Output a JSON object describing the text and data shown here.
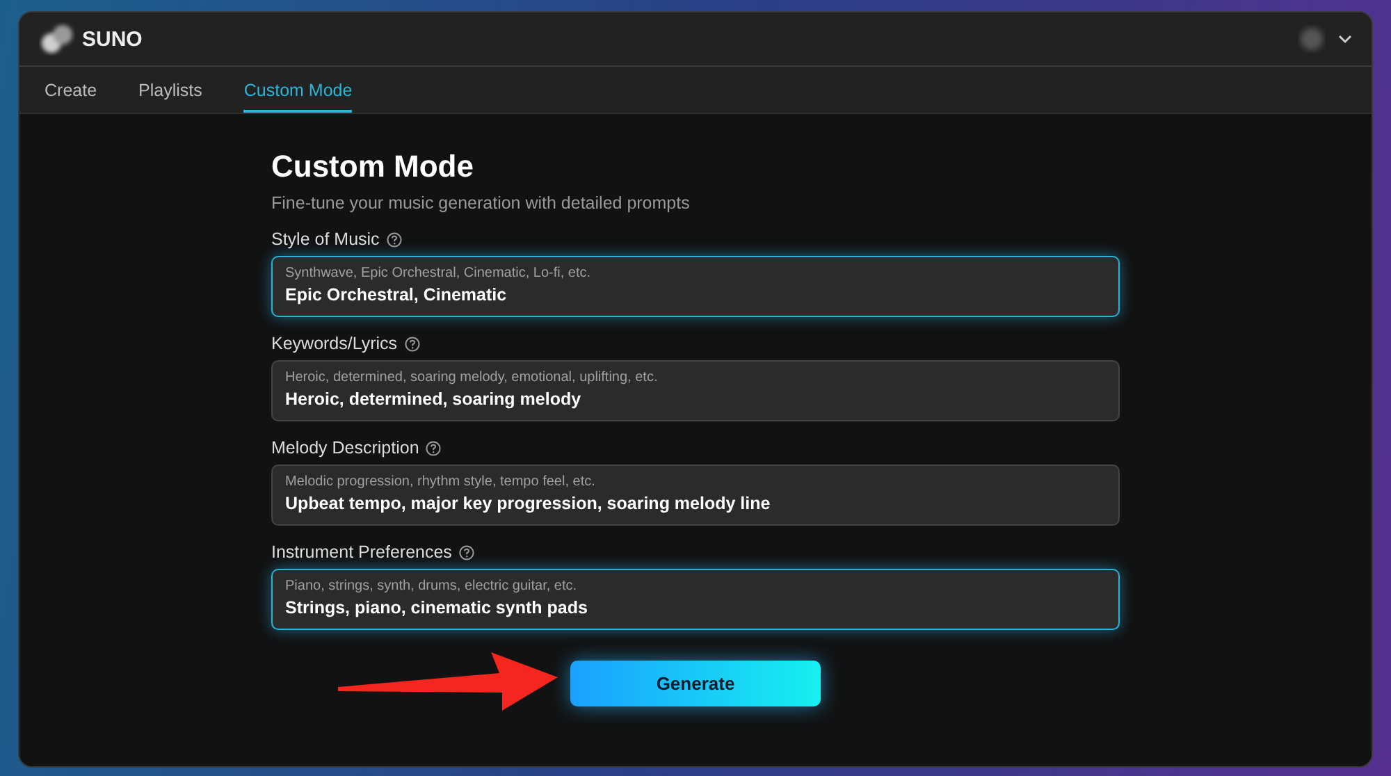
{
  "app": {
    "name": "SUNO"
  },
  "tabs": [
    {
      "label": "Create",
      "selected": false
    },
    {
      "label": "Playlists",
      "selected": false
    },
    {
      "label": "Custom Mode",
      "selected": true
    }
  ],
  "page": {
    "title": "Custom Mode",
    "subtitle": "Fine-tune your music generation with detailed prompts"
  },
  "fields": [
    {
      "label": "Style of Music",
      "hint": "Synthwave, Epic Orchestral, Cinematic, Lo-fi, etc.",
      "value": "Epic Orchestral, Cinematic",
      "focused": true
    },
    {
      "label": "Keywords/Lyrics",
      "hint": "Heroic, determined, soaring melody, emotional, uplifting, etc.",
      "value": "Heroic, determined, soaring melody",
      "focused": false
    },
    {
      "label": "Melody Description",
      "hint": "Melodic progression, rhythm style, tempo feel, etc.",
      "value": "Upbeat tempo, major key progression, soaring melody line",
      "focused": false
    },
    {
      "label": "Instrument Preferences",
      "hint": "Piano, strings, synth, drums, electric guitar, etc.",
      "value": "Strings, piano, cinematic synth pads",
      "focused": true
    }
  ],
  "button": {
    "label": "Generate"
  }
}
